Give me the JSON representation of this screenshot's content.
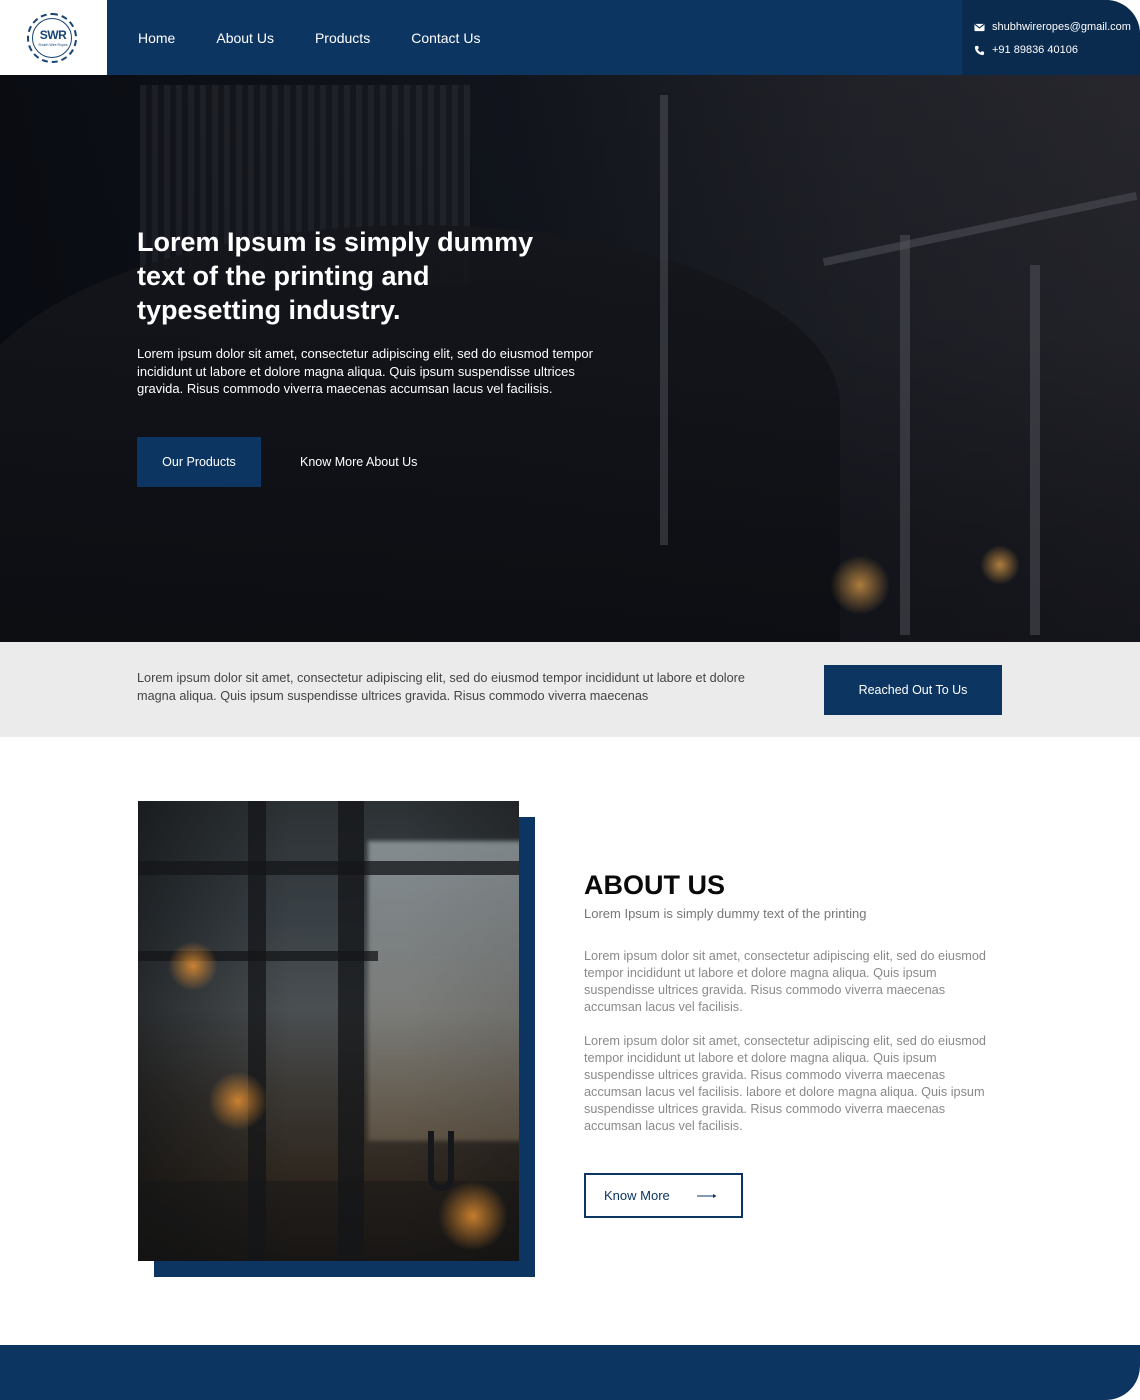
{
  "logo": {
    "text": "SWR",
    "subtext": "Shubh Wire Ropes"
  },
  "nav": {
    "items": [
      "Home",
      "About Us",
      "Products",
      "Contact Us"
    ]
  },
  "contact": {
    "email": "shubhwireropes@gmail.com",
    "phone": "+91 89836 40106"
  },
  "hero": {
    "title": "Lorem Ipsum is simply dummy text of the printing and typesetting industry.",
    "text": "Lorem ipsum dolor sit amet, consectetur adipiscing elit, sed do eiusmod tempor incididunt ut labore et dolore magna aliqua. Quis ipsum suspendisse ultrices gravida. Risus commodo viverra maecenas accumsan lacus vel facilisis.",
    "primary_button": "Our Products",
    "secondary_button": "Know More About Us"
  },
  "cta": {
    "text": "Lorem ipsum dolor sit amet, consectetur adipiscing elit, sed do eiusmod tempor incididunt ut labore et dolore magna aliqua. Quis ipsum suspendisse ultrices gravida. Risus commodo viverra maecenas",
    "button": "Reached Out To Us"
  },
  "about": {
    "title": "ABOUT US",
    "subtitle": "Lorem Ipsum is simply dummy text of the printing",
    "paragraph1": "Lorem ipsum dolor sit amet, consectetur adipiscing elit, sed do eiusmod tempor incididunt ut labore et dolore magna aliqua. Quis ipsum suspendisse ultrices gravida. Risus commodo viverra maecenas accumsan lacus vel facilisis.",
    "paragraph2": "Lorem ipsum dolor sit amet, consectetur adipiscing elit, sed do eiusmod tempor incididunt ut labore et dolore magna aliqua. Quis ipsum suspendisse ultrices gravida. Risus commodo viverra maecenas accumsan lacus vel facilisis. labore et dolore magna aliqua. Quis ipsum suspendisse ultrices gravida. Risus commodo viverra maecenas accumsan lacus vel facilisis.",
    "button": "Know More"
  },
  "colors": {
    "primary": "#0d3562",
    "contact_bg": "#0a2a4e",
    "strip_bg": "#ebebeb"
  },
  "icons": {
    "email": "mail-icon",
    "phone": "phone-icon",
    "arrow": "arrow-right-icon"
  }
}
